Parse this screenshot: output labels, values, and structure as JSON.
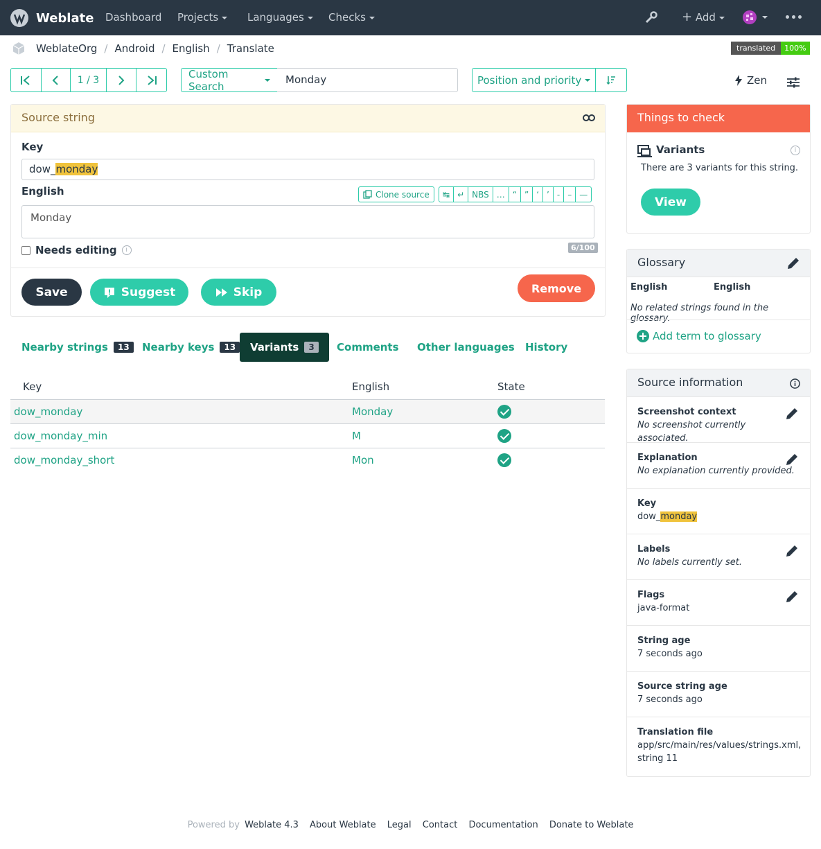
{
  "nav": {
    "brand": "Weblate",
    "items": [
      "Dashboard",
      "Projects",
      "Languages",
      "Checks"
    ],
    "add_label": "Add"
  },
  "breadcrumb": [
    "WeblateOrg",
    "Android",
    "English",
    "Translate"
  ],
  "badge": {
    "label": "translated",
    "value": "100%"
  },
  "toolbar": {
    "position": "1 / 3",
    "search_mode": "Custom Search",
    "search_value": "Monday",
    "sort": "Position and priority",
    "zen": "Zen"
  },
  "source_panel": {
    "title": "Source string",
    "key_label": "Key",
    "key_prefix": "dow_",
    "key_highlight": "monday",
    "lang_label": "English",
    "clone_label": "Clone source",
    "special_chars": [
      "↹",
      "↵",
      "NBS",
      "…",
      "“",
      "”",
      "‘",
      "’",
      "-",
      "–",
      "—"
    ],
    "text": "Monday",
    "counter": "6/100",
    "needs_editing": "Needs editing",
    "save": "Save",
    "suggest": "Suggest",
    "skip": "Skip",
    "remove": "Remove"
  },
  "tabs": [
    {
      "label": "Nearby strings",
      "count": "13"
    },
    {
      "label": "Nearby keys",
      "count": "13"
    },
    {
      "label": "Variants",
      "count": "3"
    },
    {
      "label": "Comments"
    },
    {
      "label": "Other languages"
    },
    {
      "label": "History"
    }
  ],
  "variants_table": {
    "headers": [
      "Key",
      "English",
      "State"
    ],
    "rows": [
      {
        "key": "dow_monday",
        "english": "Monday"
      },
      {
        "key": "dow_monday_min",
        "english": "M"
      },
      {
        "key": "dow_monday_short",
        "english": "Mon"
      }
    ]
  },
  "checks": {
    "title": "Things to check",
    "item_title": "Variants",
    "item_text": "There are 3 variants for this string.",
    "view": "View"
  },
  "glossary": {
    "title": "Glossary",
    "col1": "English",
    "col2": "English",
    "empty": "No related strings found in the glossary.",
    "add": "Add term to glossary"
  },
  "source_info": {
    "title": "Source information",
    "rows": [
      {
        "title": "Screenshot context",
        "value": "No screenshot currently associated."
      },
      {
        "title": "Explanation",
        "value": "No explanation currently provided."
      },
      {
        "title": "Key",
        "value_prefix": "dow_",
        "value_highlight": "monday"
      },
      {
        "title": "Labels",
        "value": "No labels currently set."
      },
      {
        "title": "Flags",
        "value": "java-format"
      },
      {
        "title": "String age",
        "value": "7 seconds ago"
      },
      {
        "title": "Source string age",
        "value": "7 seconds ago"
      },
      {
        "title": "Translation file",
        "value": "app/src/main/res/values/strings.xml, string 11"
      }
    ]
  },
  "footer": {
    "powered": "Powered by",
    "version": "Weblate 4.3",
    "links": [
      "About Weblate",
      "Legal",
      "Contact",
      "Documentation",
      "Donate to Weblate"
    ]
  },
  "colors": {
    "navbar": "#2a3744",
    "accent": "#2eccaa",
    "danger": "#f6664c"
  }
}
